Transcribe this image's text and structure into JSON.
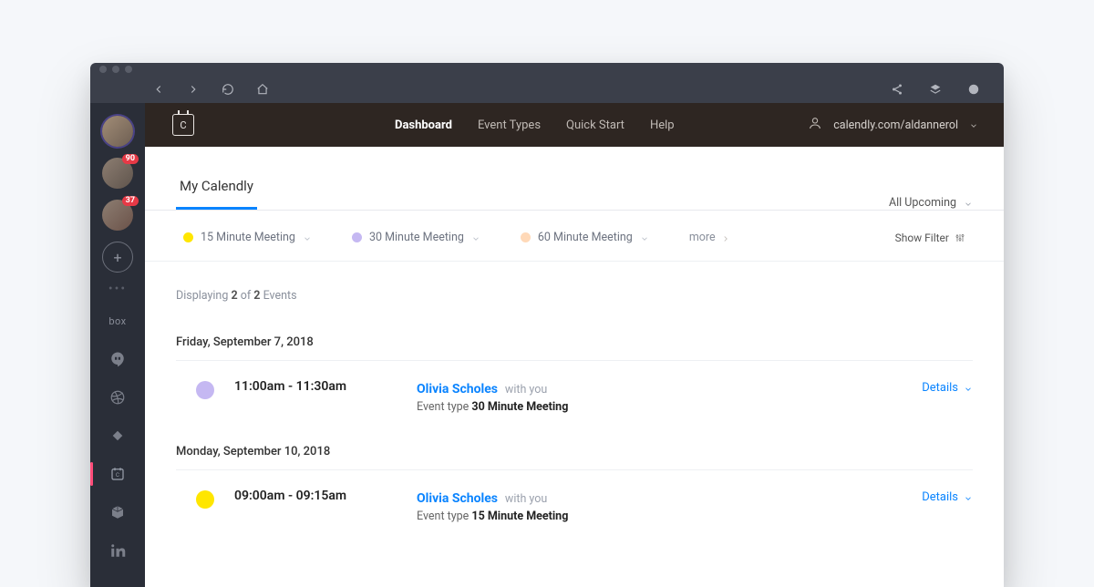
{
  "dock": {
    "avatars": [
      {
        "badge": ""
      },
      {
        "badge": "90"
      },
      {
        "badge": "37"
      }
    ]
  },
  "header": {
    "logo_letter": "C",
    "nav": {
      "dashboard": "Dashboard",
      "event_types": "Event Types",
      "quick_start": "Quick Start",
      "help": "Help"
    },
    "user_url": "calendly.com/aldannerol"
  },
  "page": {
    "tab_title": "My Calendly",
    "filter_dropdown": "All Upcoming",
    "chips": {
      "c15": "15 Minute Meeting",
      "c30": "30 Minute Meeting",
      "c60": "60 Minute Meeting",
      "more": "more"
    },
    "show_filter": "Show Filter",
    "count_prefix": "Displaying ",
    "count_num1": "2",
    "count_of": " of ",
    "count_num2": "2",
    "count_suffix": " Events"
  },
  "events": [
    {
      "day_label": "Friday, September 7, 2018",
      "dot_color": "#c5b8f2",
      "time": "11:00am - 11:30am",
      "name": "Olivia Scholes",
      "with": "with you",
      "type_prefix": "Event type ",
      "type_name": "30 Minute Meeting",
      "details": "Details"
    },
    {
      "day_label": "Monday, September 10, 2018",
      "dot_color": "#ffe600",
      "time": "09:00am - 09:15am",
      "name": "Olivia Scholes",
      "with": "with you",
      "type_prefix": "Event type ",
      "type_name": "15 Minute Meeting",
      "details": "Details"
    }
  ]
}
